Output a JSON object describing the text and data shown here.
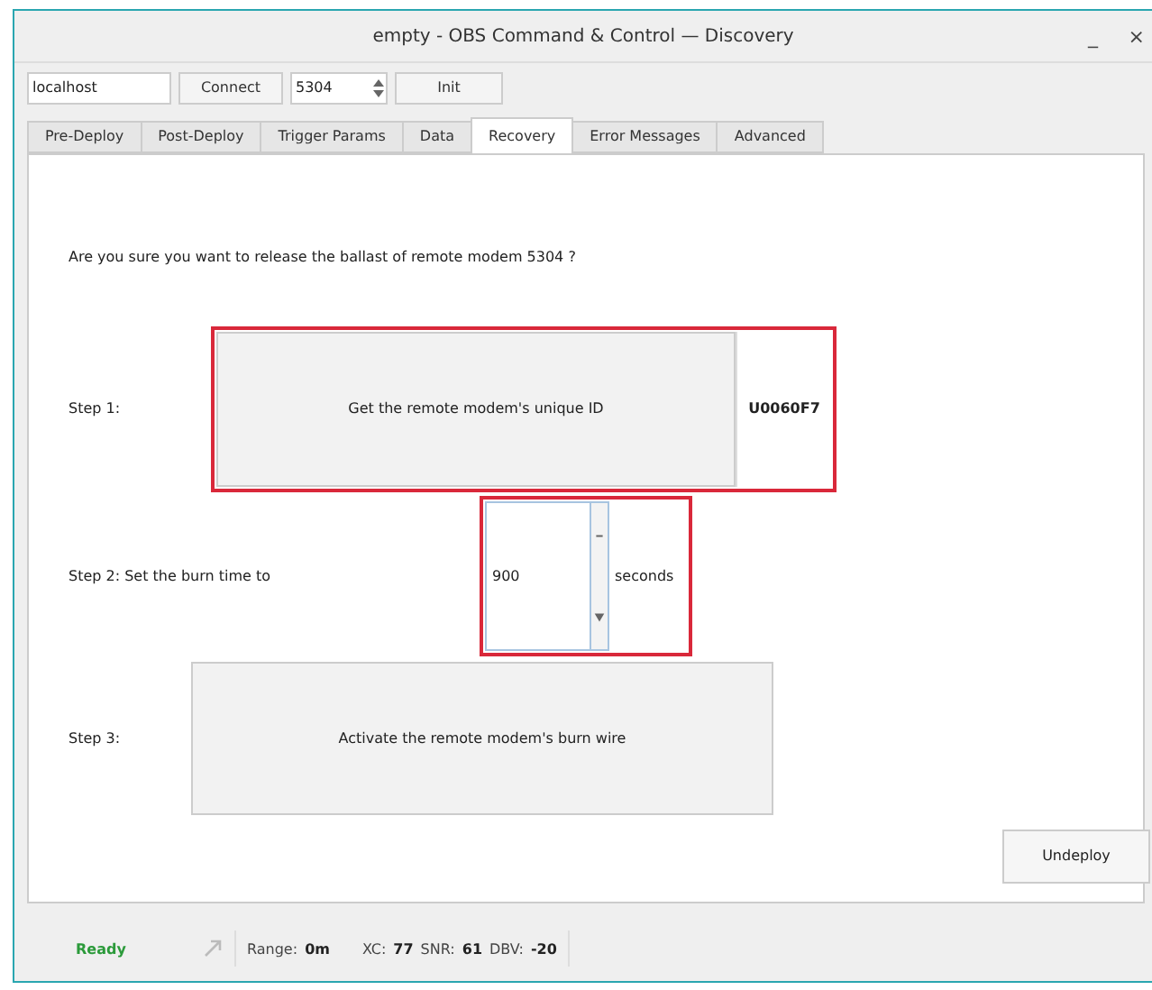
{
  "window": {
    "title": "empty - OBS Command & Control — Discovery",
    "controls": [
      "_",
      "×"
    ]
  },
  "toolbar": {
    "host": "localhost",
    "connect": "Connect",
    "port": "5304",
    "init": "Init"
  },
  "tabs": [
    {
      "label": "Pre-Deploy",
      "selected": false
    },
    {
      "label": "Post-Deploy",
      "selected": false
    },
    {
      "label": "Trigger Params",
      "selected": false
    },
    {
      "label": "Data",
      "selected": false
    },
    {
      "label": "Recovery",
      "selected": true
    },
    {
      "label": "Error Messages",
      "selected": false
    },
    {
      "label": "Advanced",
      "selected": false
    }
  ],
  "recovery": {
    "question": "Are you sure you want to release the ballast of remote modem 5304 ?",
    "step1": {
      "label": "Step 1:",
      "button": "Get the remote modem's unique ID",
      "result": "U0060F7"
    },
    "step2": {
      "label": "Step 2:  Set the burn time to",
      "value": "900",
      "unit": "seconds"
    },
    "step3": {
      "label": "Step 3:",
      "button": "Activate the remote modem's burn wire"
    },
    "undeploy": "Undeploy"
  },
  "status_bar": {
    "state": "Ready",
    "range_label": "Range:",
    "range": "0m",
    "xc_label": "XC:",
    "xc": "77",
    "snr_label": "SNR:",
    "snr": "61",
    "dbv_label": "DBV:",
    "dbv": "-20"
  }
}
